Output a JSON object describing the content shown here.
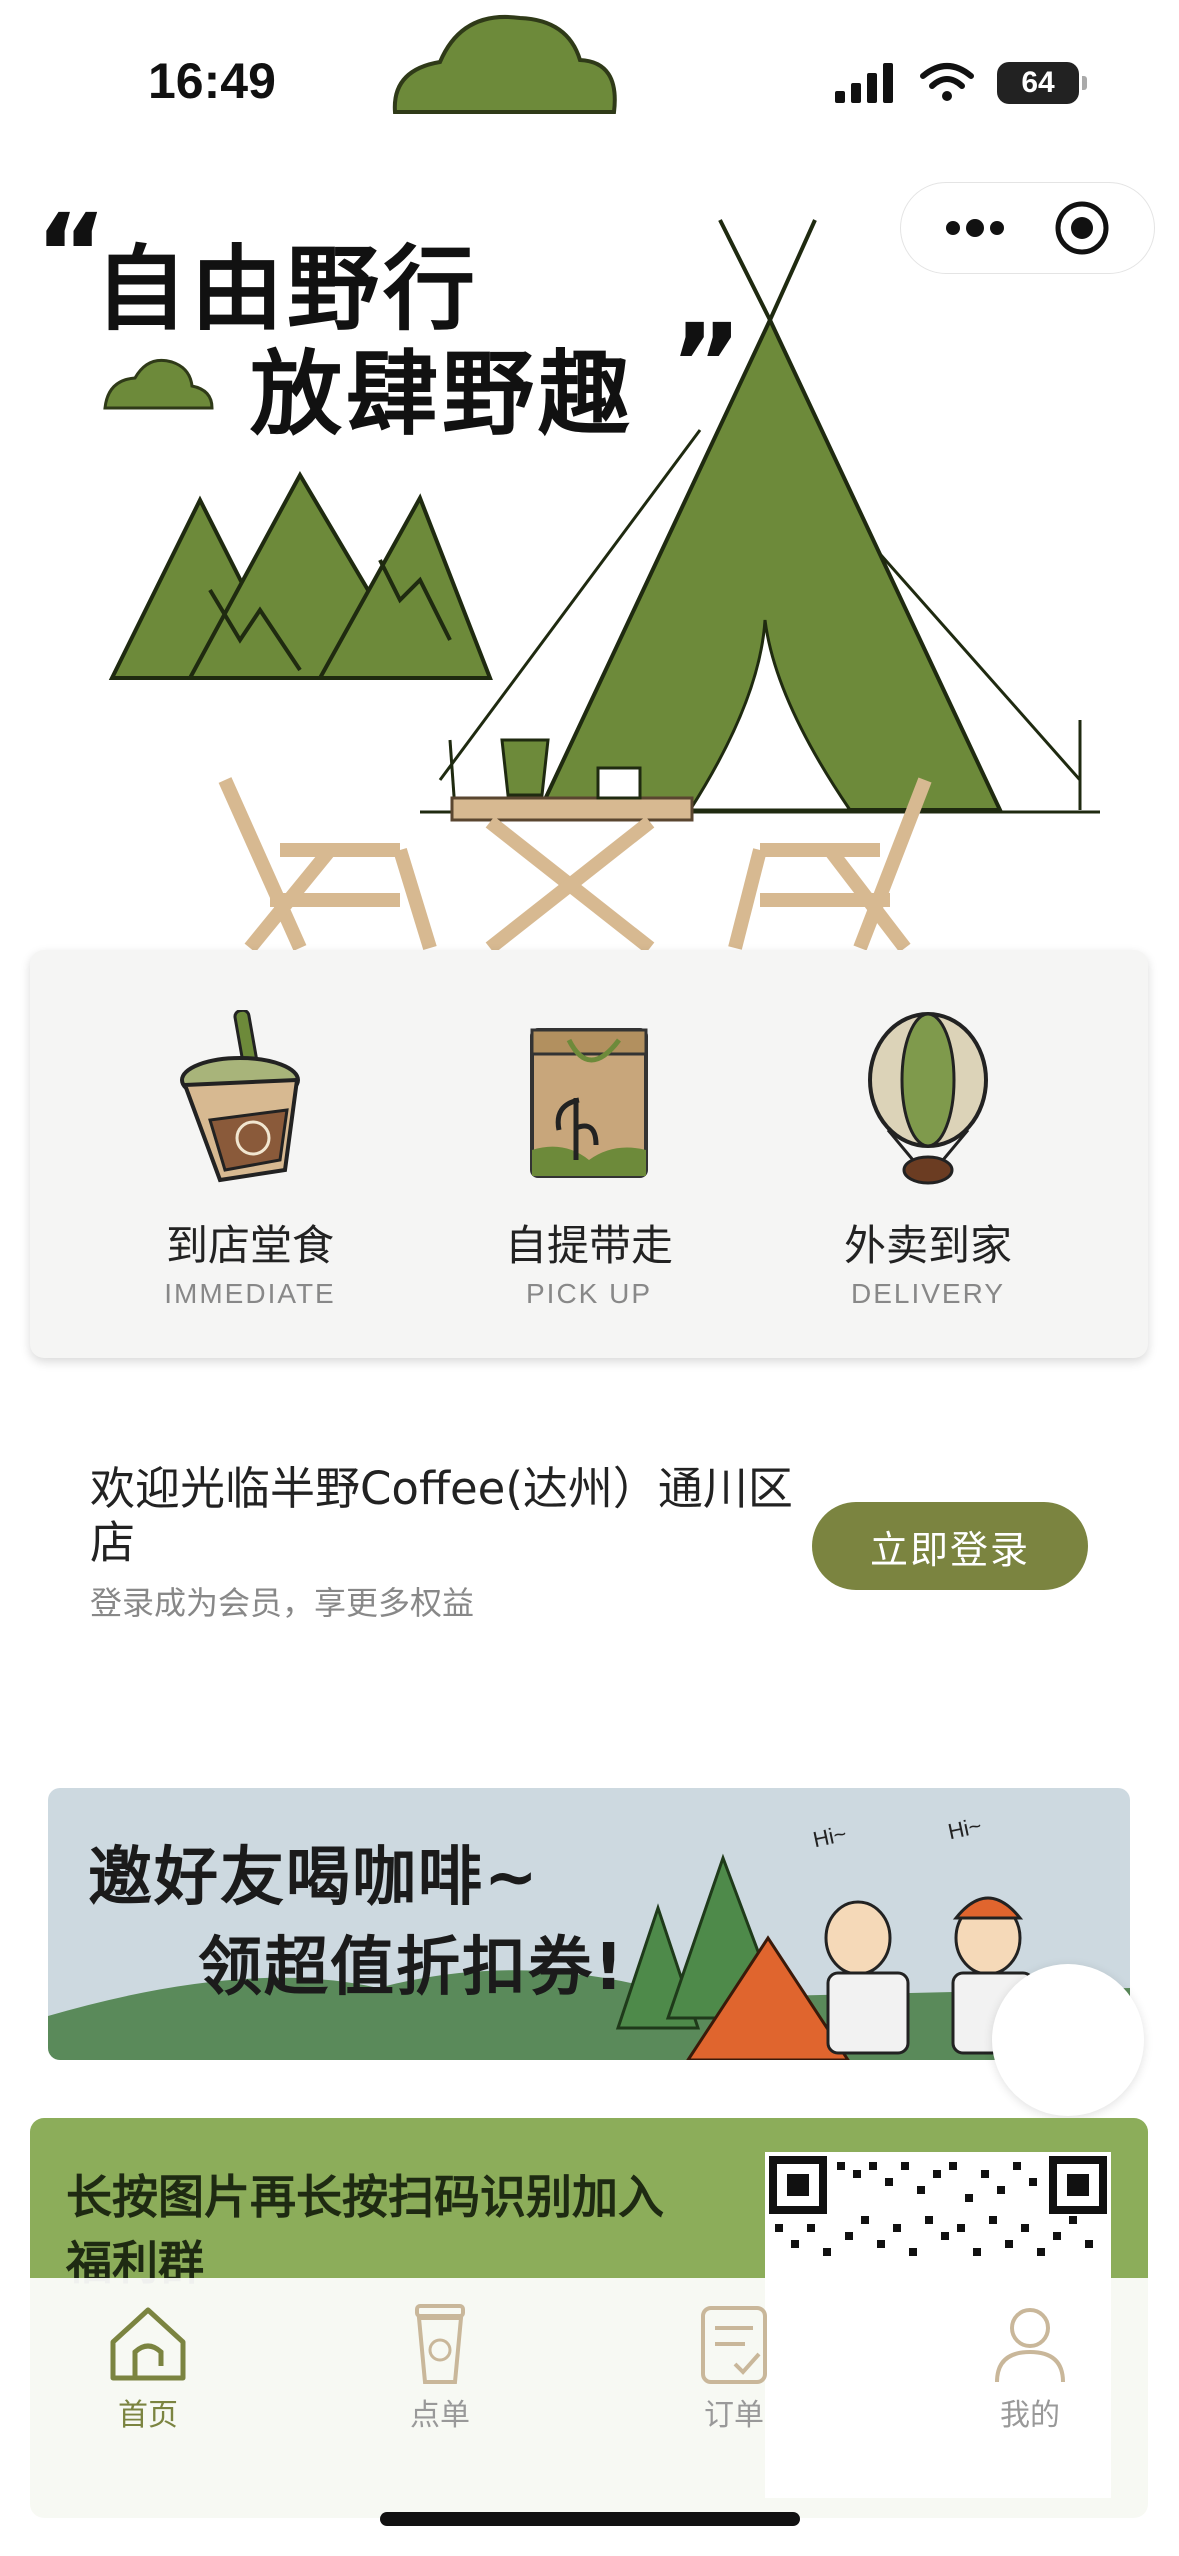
{
  "status_bar": {
    "time": "16:49",
    "battery": "64"
  },
  "hero": {
    "quote_open": "“",
    "line1": "自由野行",
    "line2": "放肆野趣",
    "quote_close": "”",
    "colors": {
      "tent": "#6d8a3a",
      "mountain": "#6d8a3a",
      "wood": "#d7b991"
    }
  },
  "services": [
    {
      "title": "到店堂食",
      "subtitle": "IMMEDIATE",
      "icon": "coffee-cup-icon"
    },
    {
      "title": "自提带走",
      "subtitle": "PICK UP",
      "icon": "paper-bag-icon"
    },
    {
      "title": "外卖到家",
      "subtitle": "DELIVERY",
      "icon": "hot-air-balloon-icon"
    }
  ],
  "welcome": {
    "title": "欢迎光临半野Coffee(达州）通川区店",
    "subtitle": "登录成为会员，享更多权益",
    "login_label": "立即登录"
  },
  "banner": {
    "line1": "邀好友喝咖啡~",
    "line2": "领超值折扣券!",
    "hi1": "Hi~",
    "hi2": "Hi~"
  },
  "group": {
    "text": "长按图片再长按扫码识别加入福利群"
  },
  "tabs": [
    {
      "label": "首页",
      "icon": "home-icon",
      "active": true
    },
    {
      "label": "点单",
      "icon": "cup-icon",
      "active": false
    },
    {
      "label": "订单",
      "icon": "order-icon",
      "active": false
    },
    {
      "label": "我的",
      "icon": "user-icon",
      "active": false
    }
  ],
  "colors": {
    "accent": "#7b8440",
    "group_bg": "#8cad5a"
  }
}
